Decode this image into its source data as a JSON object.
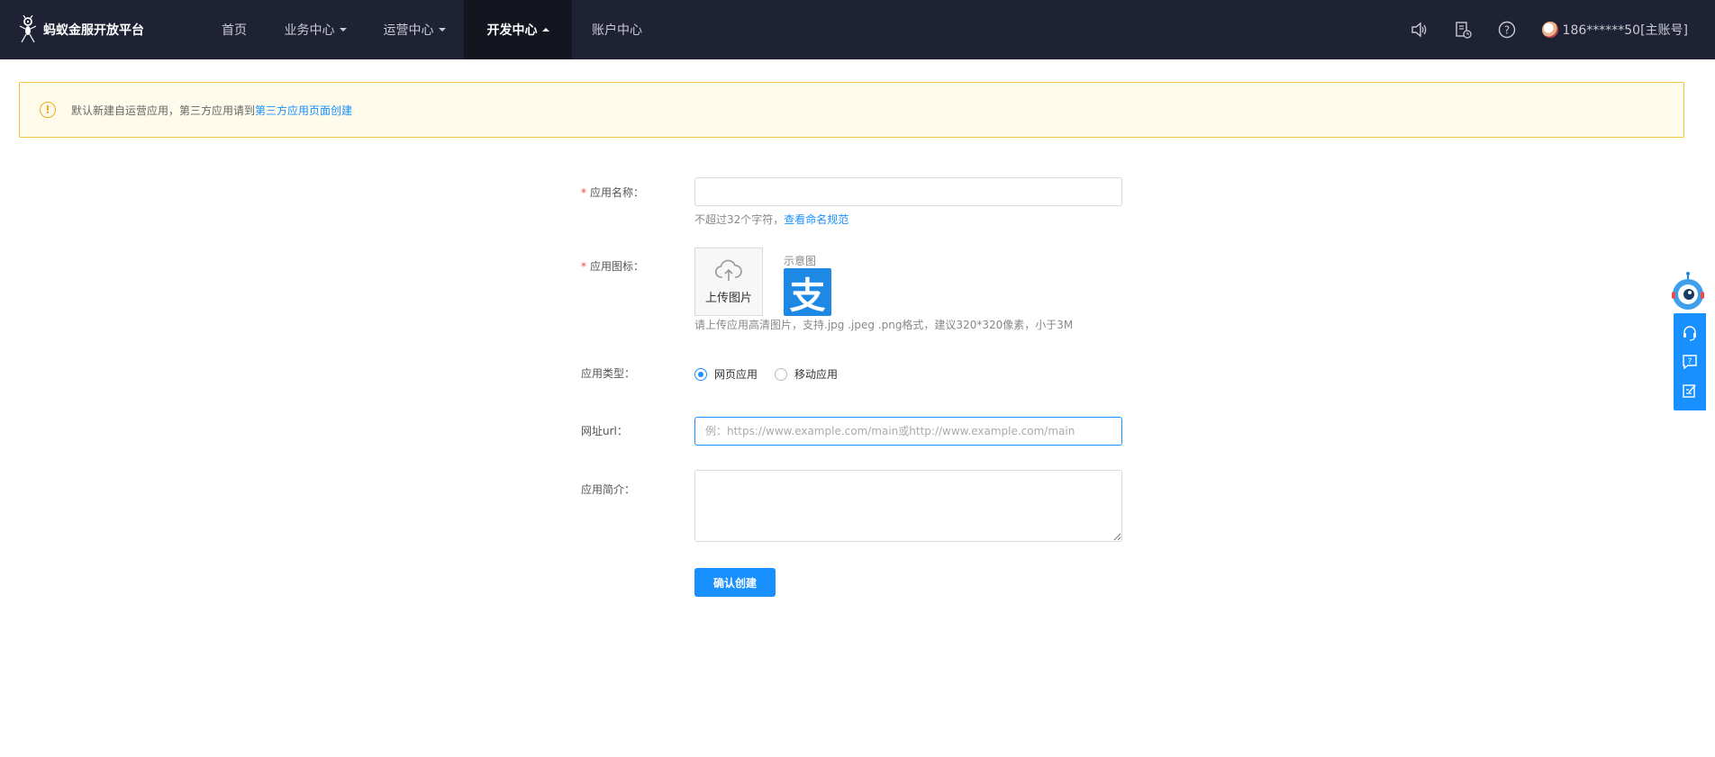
{
  "header": {
    "brand": "蚂蚁金服开放平台",
    "nav": [
      {
        "label": "首页",
        "caret": false,
        "active": false
      },
      {
        "label": "业务中心",
        "caret": true,
        "active": false
      },
      {
        "label": "运营中心",
        "caret": true,
        "active": false
      },
      {
        "label": "开发中心",
        "caret": true,
        "active": true
      },
      {
        "label": "账户中心",
        "caret": false,
        "active": false
      }
    ],
    "icons": [
      "speaker-icon",
      "document-clock-icon",
      "help-icon"
    ],
    "user": "186******50[主账号]"
  },
  "alert": {
    "text": "默认新建自运营应用，第三方应用请到",
    "link": "第三方应用页面创建"
  },
  "form": {
    "name_label": "应用名称：",
    "name_value": "",
    "name_hint": "不超过32个字符，",
    "name_hint_link": "查看命名规范",
    "icon_label": "应用图标：",
    "upload_label": "上传图片",
    "sample_label": "示意图",
    "sample_glyph": "支",
    "icon_hint": "请上传应用高清图片，支持.jpg .jpeg .png格式，建议320*320像素，小于3M",
    "type_label": "应用类型：",
    "type_options": [
      {
        "label": "网页应用",
        "checked": true
      },
      {
        "label": "移动应用",
        "checked": false
      }
    ],
    "url_label": "网址url：",
    "url_placeholder": "例：https://www.example.com/main或http://www.example.com/main",
    "desc_label": "应用简介：",
    "submit": "确认创建"
  },
  "colors": {
    "accent": "#1890ff",
    "nav_bg": "#1e2234",
    "alert_bg": "#fffbea",
    "alert_border": "#f4c543"
  }
}
